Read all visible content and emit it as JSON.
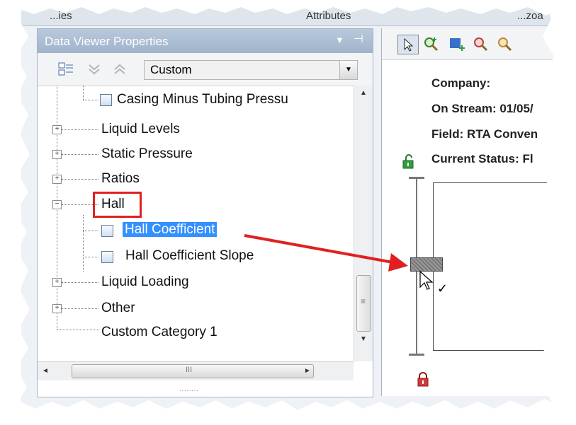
{
  "top_strip": {
    "text_left": "...ies",
    "text_mid": "Attributes",
    "text_right": "...zoa"
  },
  "panel": {
    "title": "Data Viewer Properties",
    "dropdown_glyph": "▼",
    "pin_glyph": "⊣",
    "combo_value": "Custom",
    "combo_arrow": "▼"
  },
  "tree": {
    "items": [
      {
        "label": "Casing Minus Tubing Pressu",
        "level": 2,
        "checkbox": true
      },
      {
        "label": "Liquid Levels",
        "level": 1,
        "expander": "+"
      },
      {
        "label": "Static Pressure",
        "level": 1,
        "expander": "+"
      },
      {
        "label": "Ratios",
        "level": 1,
        "expander": "+"
      },
      {
        "label": "Hall",
        "level": 1,
        "expander": "−",
        "highlighted": true
      },
      {
        "label": "Hall Coefficient",
        "level": 2,
        "checkbox": true,
        "selected": true
      },
      {
        "label": "Hall Coefficient Slope",
        "level": 2,
        "checkbox": true
      },
      {
        "label": "Liquid Loading",
        "level": 1,
        "expander": "+"
      },
      {
        "label": "Other",
        "level": 1,
        "expander": "+"
      },
      {
        "label": "Custom Category 1",
        "level": 1
      }
    ]
  },
  "scroll": {
    "up": "▲",
    "down": "▼",
    "left": "◄",
    "right": "►",
    "grip": "III",
    "resize_grip": "........"
  },
  "right_panel": {
    "company_label": "Company:",
    "on_stream_label": "On Stream: 01/05/",
    "field_label": "Field: RTA Conven",
    "status_label": "Current Status: Fl",
    "checkmark": "✓"
  },
  "colors": {
    "selection": "#3390ff",
    "highlight_box": "#e02020",
    "arrow": "#e02020",
    "title_bar": "#a9bdd4",
    "lock_open": "#2f9e3b",
    "lock_closed": "#d43a3a"
  },
  "icons": [
    "collapse-all-icon",
    "expand-all-icon",
    "sort-icon",
    "pointer-tool-icon",
    "zoom-add-icon",
    "add-track-icon",
    "zoom-in-icon",
    "zoom-icon",
    "lock-open-icon",
    "lock-closed-icon",
    "cursor-icon"
  ]
}
